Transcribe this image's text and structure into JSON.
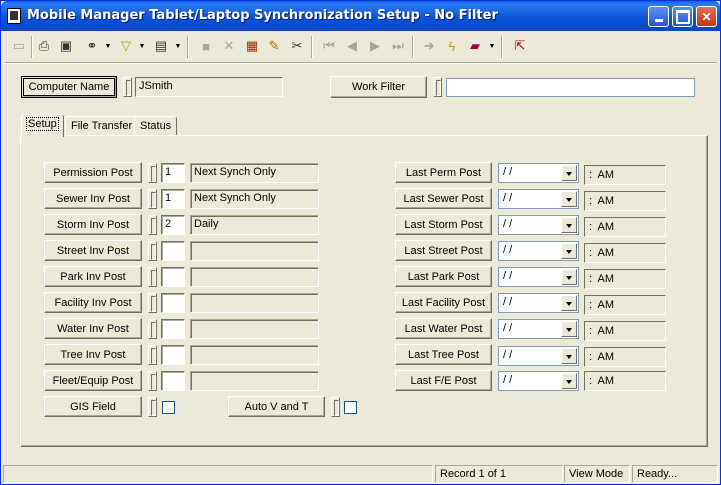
{
  "window": {
    "title": "Mobile Manager Tablet/Laptop Synchronization Setup - No Filter"
  },
  "icons": {
    "toolbar": [
      "form-icon",
      "print-icon",
      "print-preview-icon",
      "binoculars-icon",
      "filter-icon",
      "report-icon",
      "save-icon",
      "delete-icon",
      "books-icon",
      "edit-pencil-icon",
      "cut-scissors-icon",
      "first-record-icon",
      "previous-record-icon",
      "next-record-icon",
      "last-record-icon",
      "go-arrow-icon",
      "lightning-icon",
      "book-icon",
      "exit-icon"
    ]
  },
  "header": {
    "computer_name_label": "Computer Name",
    "computer_name_value": "JSmith",
    "work_filter_label": "Work Filter",
    "work_filter_value": ""
  },
  "tabs": [
    {
      "label": "Setup"
    },
    {
      "label": "File Transfer"
    },
    {
      "label": "Status"
    }
  ],
  "posts": [
    {
      "label": "Permission Post",
      "num": "1",
      "desc": "Next Synch Only"
    },
    {
      "label": "Sewer Inv Post",
      "num": "1",
      "desc": "Next Synch Only"
    },
    {
      "label": "Storm Inv Post",
      "num": "2",
      "desc": "Daily"
    },
    {
      "label": "Street Inv Post",
      "num": "",
      "desc": ""
    },
    {
      "label": "Park Inv Post",
      "num": "",
      "desc": ""
    },
    {
      "label": "Facility Inv Post",
      "num": "",
      "desc": ""
    },
    {
      "label": "Water Inv Post",
      "num": "",
      "desc": ""
    },
    {
      "label": "Tree Inv Post",
      "num": "",
      "desc": ""
    },
    {
      "label": "Fleet/Equip Post",
      "num": "",
      "desc": ""
    }
  ],
  "gis_field_label": "GIS Field",
  "auto_v_and_t_label": "Auto V and T",
  "last_posts": [
    {
      "label": "Last Perm Post",
      "date": "/ /",
      "time": ":  AM"
    },
    {
      "label": "Last Sewer Post",
      "date": "/ /",
      "time": ":  AM"
    },
    {
      "label": "Last Storm Post",
      "date": "/ /",
      "time": ":  AM"
    },
    {
      "label": "Last Street Post",
      "date": "/ /",
      "time": ":  AM"
    },
    {
      "label": "Last Park Post",
      "date": "/ /",
      "time": ":  AM"
    },
    {
      "label": "Last Facility Post",
      "date": "/ /",
      "time": ":  AM"
    },
    {
      "label": "Last Water Post",
      "date": "/ /",
      "time": ":  AM"
    },
    {
      "label": "Last Tree Post",
      "date": "/ /",
      "time": ":  AM"
    },
    {
      "label": "Last F/E Post",
      "date": "/ /",
      "time": ":  AM"
    }
  ],
  "status": {
    "record": "Record 1 of 1",
    "mode": "View Mode",
    "state": "Ready..."
  }
}
